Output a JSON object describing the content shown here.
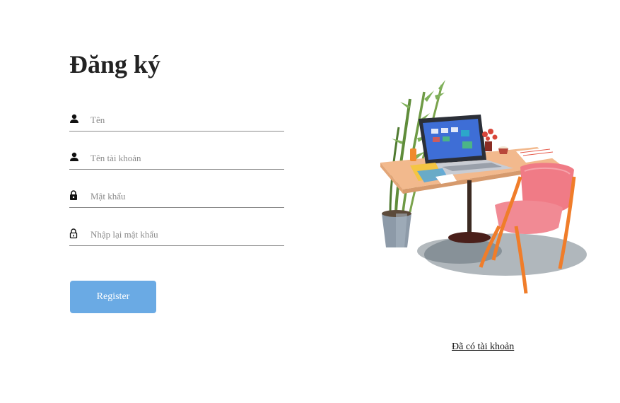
{
  "form": {
    "title": "Đăng ký",
    "fields": [
      {
        "placeholder": "Tên",
        "icon": "person-icon"
      },
      {
        "placeholder": "Tên tài khoản",
        "icon": "person-icon"
      },
      {
        "placeholder": "Mật khẩu",
        "icon": "lock-icon"
      },
      {
        "placeholder": "Nhập lại mật khẩu",
        "icon": "lock-outline-icon"
      }
    ],
    "register_label": "Register"
  },
  "side": {
    "illustration": "desk-laptop-chair-illustration",
    "login_link": "Đã có tài khoản"
  },
  "colors": {
    "button": "#6aaae4",
    "underline": "#8a8a8a"
  }
}
